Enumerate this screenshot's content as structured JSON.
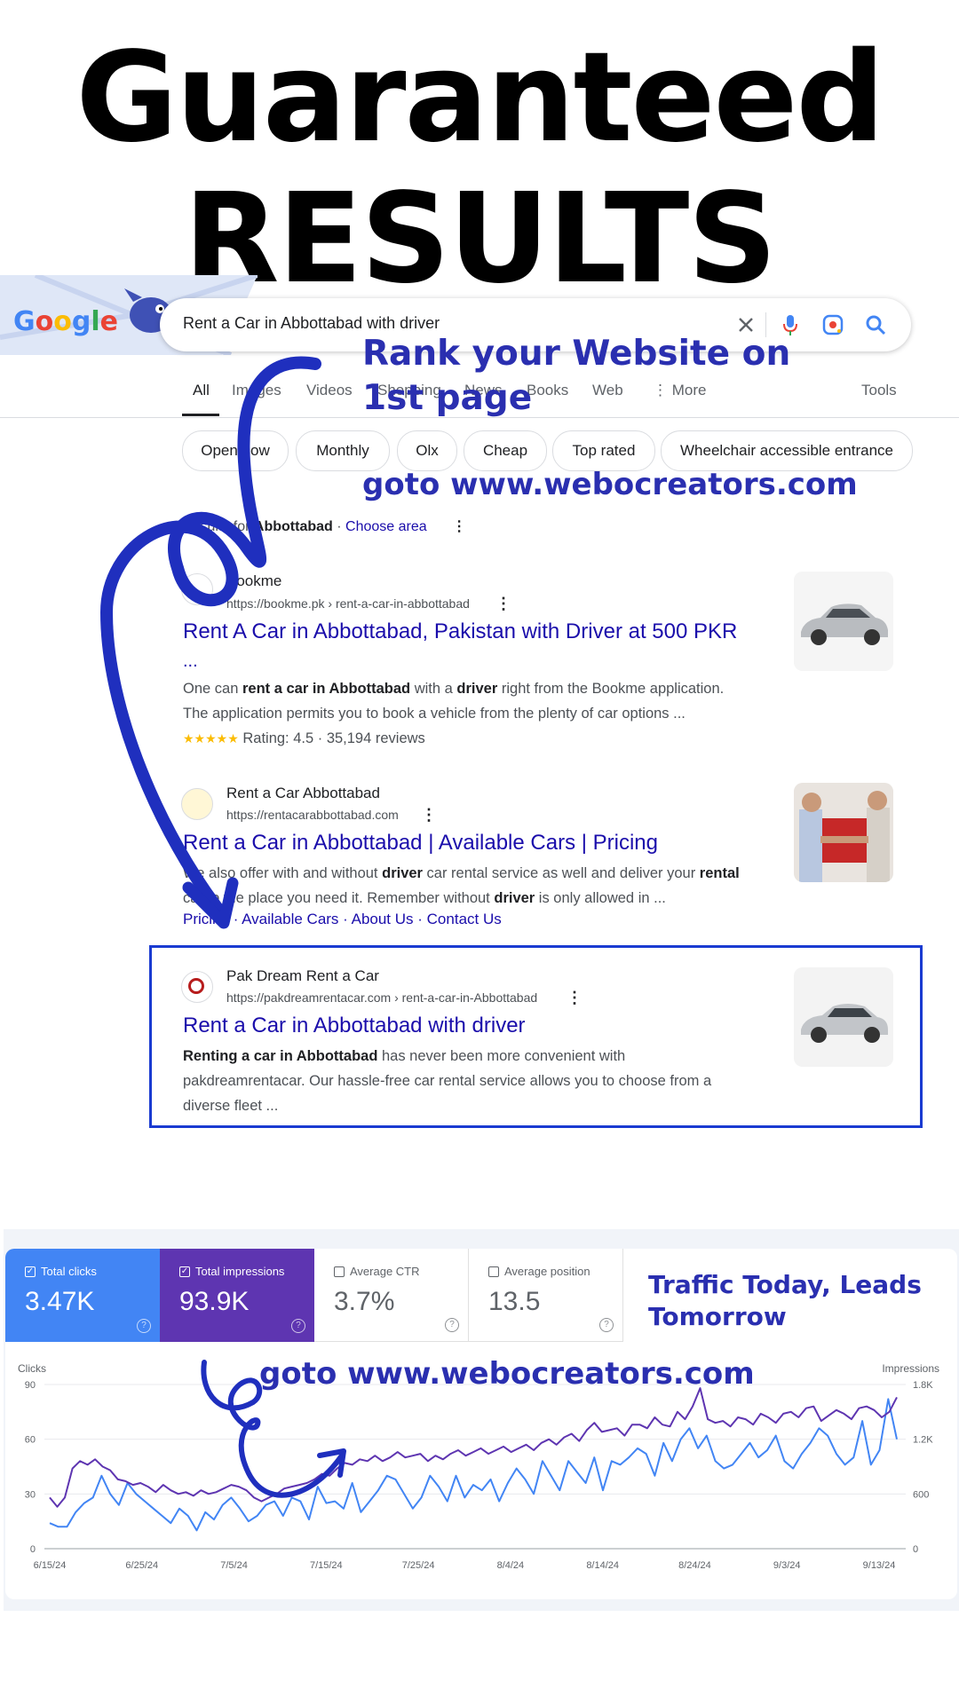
{
  "headline": {
    "line1": "Guaranteed",
    "line2": "RESULTS"
  },
  "google": {
    "logo_text": "Google",
    "query": "Rent a Car in Abbottabad with driver",
    "tabs": [
      {
        "label": "All",
        "active": true
      },
      {
        "label": "Images"
      },
      {
        "label": "Videos"
      },
      {
        "label": "Shopping"
      },
      {
        "label": "News"
      },
      {
        "label": "Books"
      },
      {
        "label": "Web"
      },
      {
        "label": "⋮ More"
      },
      {
        "label": "Tools"
      }
    ],
    "chips": [
      "Open now",
      "Monthly",
      "Olx",
      "Cheap",
      "Top rated",
      "Wheelchair accessible entrance"
    ],
    "results_for": {
      "prefix": "Results for",
      "place": "Abbottabad",
      "sep": " · ",
      "choose": "Choose area"
    },
    "results": [
      {
        "site": "Bookme",
        "url": "https://bookme.pk › rent-a-car-in-abbottabad",
        "title": "Rent A Car in Abbottabad, Pakistan with Driver at 500 PKR",
        "title_cont": "...",
        "snippet_line1": [
          "One can ",
          "rent a car in Abbottabad",
          " with a ",
          "driver",
          " right from the Bookme application."
        ],
        "snippet_line2": "The application permits you to book a vehicle from the plenty of car options ...",
        "stars": "★★★★★",
        "rating": "Rating: 4.5 · 35,194 reviews"
      },
      {
        "site": "Rent a Car Abbottabad",
        "url": "https://rentacarabbottabad.com",
        "title": "Rent a Car in Abbottabad | Available Cars | Pricing",
        "snippet_line1": [
          "We also offer with and without ",
          "driver",
          " car rental service as well and deliver your ",
          "rental"
        ],
        "snippet_line2": [
          "car to the place you need it. Remember without ",
          "driver",
          " is only allowed in ..."
        ],
        "links": [
          "Pricing",
          "Available Cars",
          "About Us",
          "Contact Us"
        ]
      },
      {
        "site": "Pak Dream Rent a Car",
        "url": "https://pakdreamrentacar.com › rent-a-car-in-Abbottabad",
        "title": "Rent a Car in Abbottabad with driver",
        "snippet_line1": [
          "Renting a car in Abbottabad",
          " has never been more convenient with"
        ],
        "snippet_line2": "pakdreamrentacar. Our hassle-free car rental service allows you to choose from a",
        "snippet_line3": "diverse fleet ..."
      }
    ]
  },
  "promo": {
    "rank_line1": "Rank your Website on",
    "rank_line2": "1st page",
    "goto1": "goto www.webocreators.com",
    "traffic_line1": "Traffic Today, Leads",
    "traffic_line2": "Tomorrow",
    "goto2": "goto www.webocreators.com"
  },
  "colors": {
    "clicks": "#4285f4",
    "impressions": "#5e35b1",
    "promo": "#2a2fb0",
    "link": "#1a0dab",
    "highlight": "#1a3bd1"
  },
  "metrics": [
    {
      "label": "Total clicks",
      "value": "3.47K",
      "checked": true
    },
    {
      "label": "Total impressions",
      "value": "93.9K",
      "checked": true
    },
    {
      "label": "Average CTR",
      "value": "3.7%",
      "checked": false
    },
    {
      "label": "Average position",
      "value": "13.5",
      "checked": false
    }
  ],
  "chart_data": {
    "type": "line",
    "left_axis_label": "Clicks",
    "right_axis_label": "Impressions",
    "yticks_left": [
      "0",
      "30",
      "60",
      "90"
    ],
    "yticks_right": [
      "0",
      "600",
      "1.2K",
      "1.8K"
    ],
    "ylim_left": [
      0,
      90
    ],
    "ylim_right": [
      0,
      1800
    ],
    "xticks": [
      "6/15/24",
      "6/25/24",
      "7/5/24",
      "7/15/24",
      "7/25/24",
      "8/4/24",
      "8/14/24",
      "8/24/24",
      "9/3/24",
      "9/13/24"
    ],
    "series": [
      {
        "name": "Clicks",
        "axis": "left",
        "values": [
          14,
          12,
          12,
          20,
          25,
          28,
          40,
          30,
          24,
          36,
          30,
          26,
          22,
          18,
          14,
          22,
          18,
          10,
          20,
          16,
          24,
          28,
          22,
          15,
          18,
          24,
          26,
          18,
          28,
          26,
          16,
          34,
          25,
          26,
          22,
          36,
          20,
          26,
          32,
          40,
          38,
          30,
          22,
          28,
          40,
          34,
          26,
          40,
          28,
          35,
          32,
          38,
          26,
          36,
          44,
          38,
          30,
          48,
          40,
          32,
          48,
          42,
          36,
          50,
          32,
          48,
          46,
          50,
          55,
          52,
          40,
          58,
          48,
          60,
          66,
          55,
          62,
          48,
          44,
          46,
          52,
          58,
          50,
          54,
          62,
          48,
          44,
          52,
          58,
          66,
          62,
          52,
          46,
          50,
          70,
          46,
          54,
          82,
          60
        ]
      },
      {
        "name": "Impressions",
        "axis": "right",
        "values": [
          560,
          460,
          560,
          880,
          960,
          920,
          980,
          900,
          860,
          760,
          740,
          700,
          720,
          680,
          620,
          700,
          640,
          600,
          620,
          580,
          640,
          600,
          620,
          660,
          700,
          680,
          640,
          560,
          520,
          560,
          600,
          660,
          680,
          700,
          720,
          760,
          820,
          800,
          880,
          940,
          920,
          980,
          960,
          1020,
          960,
          1000,
          1060,
          1000,
          1020,
          1040,
          960,
          1020,
          980,
          1040,
          1080,
          1020,
          1060,
          1100,
          1040,
          1080,
          1120,
          1060,
          1100,
          1140,
          1080,
          1160,
          1200,
          1140,
          1220,
          1260,
          1180,
          1300,
          1380,
          1280,
          1300,
          1320,
          1240,
          1360,
          1360,
          1320,
          1440,
          1360,
          1340,
          1500,
          1420,
          1560,
          1760,
          1420,
          1380,
          1400,
          1340,
          1440,
          1420,
          1360,
          1480,
          1440,
          1380,
          1480,
          1500,
          1440,
          1540,
          1560,
          1400,
          1460,
          1520,
          1480,
          1420,
          1540,
          1560,
          1520,
          1440,
          1500,
          1660
        ]
      }
    ]
  }
}
